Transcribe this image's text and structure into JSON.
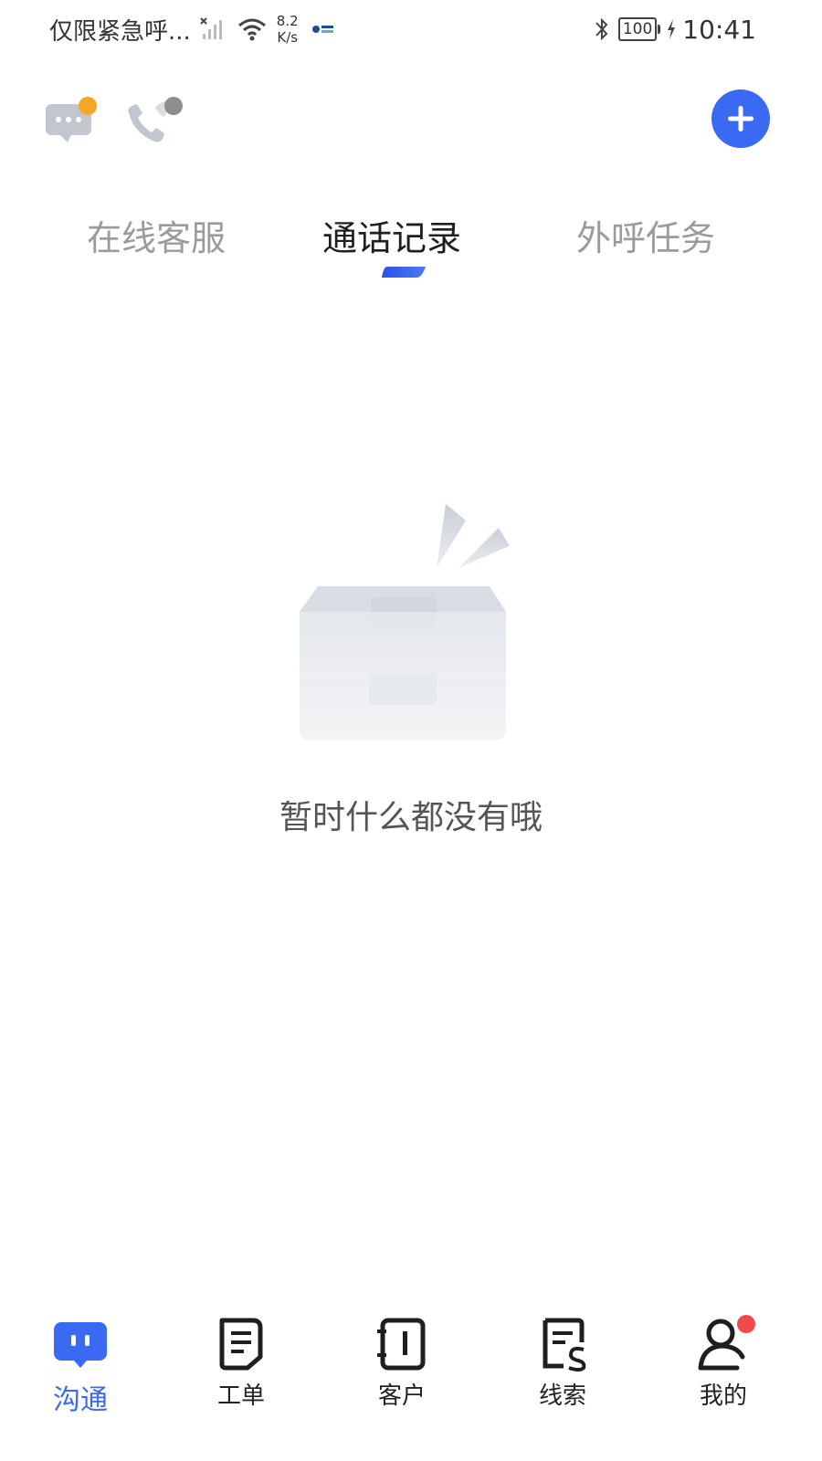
{
  "status_bar": {
    "carrier": "仅限紧急呼...",
    "net_speed_value": "8.2",
    "net_speed_unit": "K/s",
    "battery": "100",
    "time": "10:41"
  },
  "top_bar": {
    "message_badge_color": "#f5a623",
    "call_badge_color": "#8e8e8e",
    "accent": "#3a6af1"
  },
  "tabs": [
    {
      "label": "在线客服",
      "active": false
    },
    {
      "label": "通话记录",
      "active": true
    },
    {
      "label": "外呼任务",
      "active": false
    }
  ],
  "empty_state": {
    "message": "暂时什么都没有哦",
    "icon": "empty-box-icon"
  },
  "bottom_nav": {
    "items": [
      {
        "label": "沟通",
        "icon": "chat-icon",
        "active": true
      },
      {
        "label": "工单",
        "icon": "ticket-icon",
        "active": false
      },
      {
        "label": "客户",
        "icon": "customer-book-icon",
        "active": false
      },
      {
        "label": "线索",
        "icon": "leads-icon",
        "active": false
      },
      {
        "label": "我的",
        "icon": "profile-icon",
        "active": false,
        "badge": true
      }
    ]
  }
}
